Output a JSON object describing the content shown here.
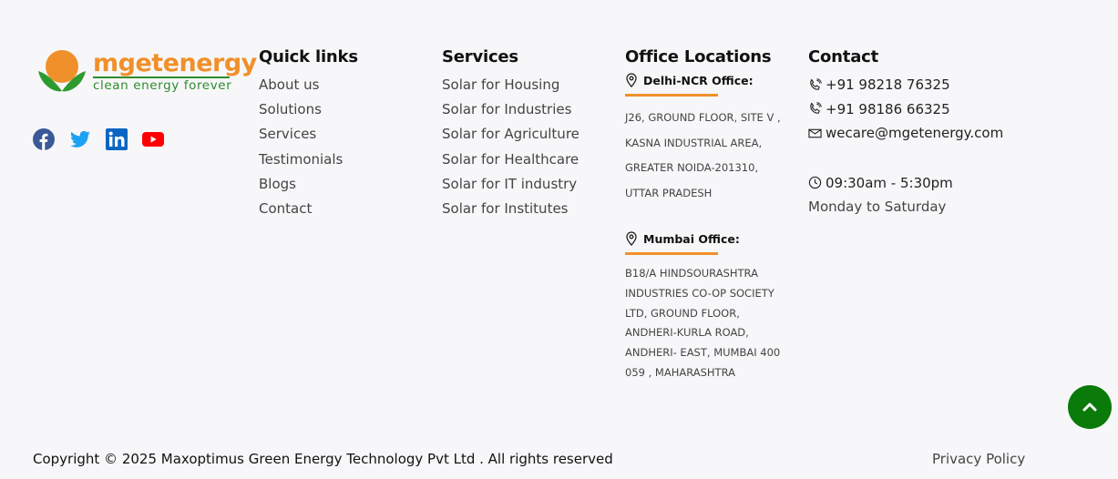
{
  "brand": {
    "name": "mgetenergy",
    "tagline": "clean energy forever",
    "colors": {
      "orange": "#f0902a",
      "green": "#2e8b2e"
    }
  },
  "social": [
    {
      "name": "facebook-icon",
      "color": "#3b5998"
    },
    {
      "name": "twitter-icon",
      "color": "#1da1f2"
    },
    {
      "name": "linkedin-icon",
      "color": "#0a66c2"
    },
    {
      "name": "youtube-icon",
      "color": "#ff0000"
    }
  ],
  "quick_links": {
    "title": "Quick links",
    "items": [
      "About us",
      "Solutions",
      "Services",
      "Testimonials",
      "Blogs",
      "Contact"
    ]
  },
  "services": {
    "title": "Services",
    "items": [
      "Solar for Housing",
      "Solar for Industries",
      "Solar for Agriculture",
      "Solar for Healthcare",
      "Solar for IT industry",
      "Solar for Institutes"
    ]
  },
  "offices": {
    "title": "Office Locations",
    "delhi": {
      "label": "Delhi-NCR Office:",
      "lines": [
        "J26, GROUND FLOOR, SITE V ,",
        "KASNA INDUSTRIAL AREA,",
        "GREATER NOIDA-201310,",
        "UTTAR PRADESH"
      ]
    },
    "mumbai": {
      "label": "Mumbai Office:",
      "lines": [
        "B18/A HINDSOURASHTRA",
        "INDUSTRIES CO-OP SOCIETY",
        "LTD, GROUND FLOOR,",
        "ANDHERI-KURLA ROAD,",
        "ANDHERI- EAST, MUMBAI 400",
        "059 , MAHARASHTRA"
      ]
    }
  },
  "contact": {
    "title": "Contact",
    "phone1": "+91 98218 76325",
    "phone2": "+91 98186 66325",
    "email": "wecare@mgetenergy.com",
    "hours": "09:30am - 5:30pm",
    "days": "Monday to Saturday"
  },
  "footer": {
    "copyright": "Copyright © 2025 Maxoptimus Green Energy Technology Pvt Ltd . All rights reserved",
    "privacy": "Privacy Policy"
  },
  "accent": "#0a7a0a"
}
